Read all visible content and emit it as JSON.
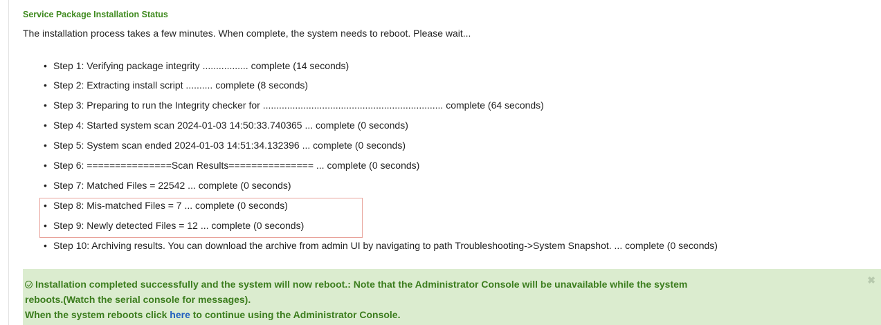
{
  "section": {
    "title": "Service Package Installation Status",
    "intro": "The installation process takes a few minutes. When complete, the system needs to reboot. Please wait..."
  },
  "steps": [
    {
      "text": "Step 1: Verifying package integrity ................. complete (14 seconds)"
    },
    {
      "text": "Step 2: Extracting install script .......... complete (8 seconds)"
    },
    {
      "text": "Step 3: Preparing to run the Integrity checker for ................................................................... complete (64 seconds)"
    },
    {
      "text": "Step 4: Started system scan 2024-01-03 14:50:33.740365 ... complete (0 seconds)"
    },
    {
      "text": "Step 5: System scan ended 2024-01-03 14:51:34.132396 ... complete (0 seconds)"
    },
    {
      "text": "Step 6: ===============Scan Results=============== ... complete (0 seconds)"
    },
    {
      "text": "Step 7: Matched Files = 22542 ... complete (0 seconds)"
    },
    {
      "text": "Step 8: Mis-matched Files = 7 ... complete (0 seconds)"
    },
    {
      "text": "Step 9: Newly detected Files = 12 ... complete (0 seconds)"
    },
    {
      "text": "Step 10: Archiving results. You can download the archive from admin UI by navigating to path Troubleshooting->System Snapshot. ... complete (0 seconds)"
    }
  ],
  "alert": {
    "line1": "Installation completed successfully and the system will now reboot.:  Note that the Administrator Console will be unavailable while the system",
    "line2": "reboots.(Watch the serial console for messages).",
    "line3_before": "When the system reboots click ",
    "link": "here",
    "line3_after": " to continue using the Administrator Console.",
    "close": "✖"
  },
  "colors": {
    "title": "#3f8a1f",
    "alert_bg": "#dbeccf",
    "alert_text": "#3c7d1e",
    "link": "#1f5fbf",
    "highlight_border": "#e8a29a"
  }
}
